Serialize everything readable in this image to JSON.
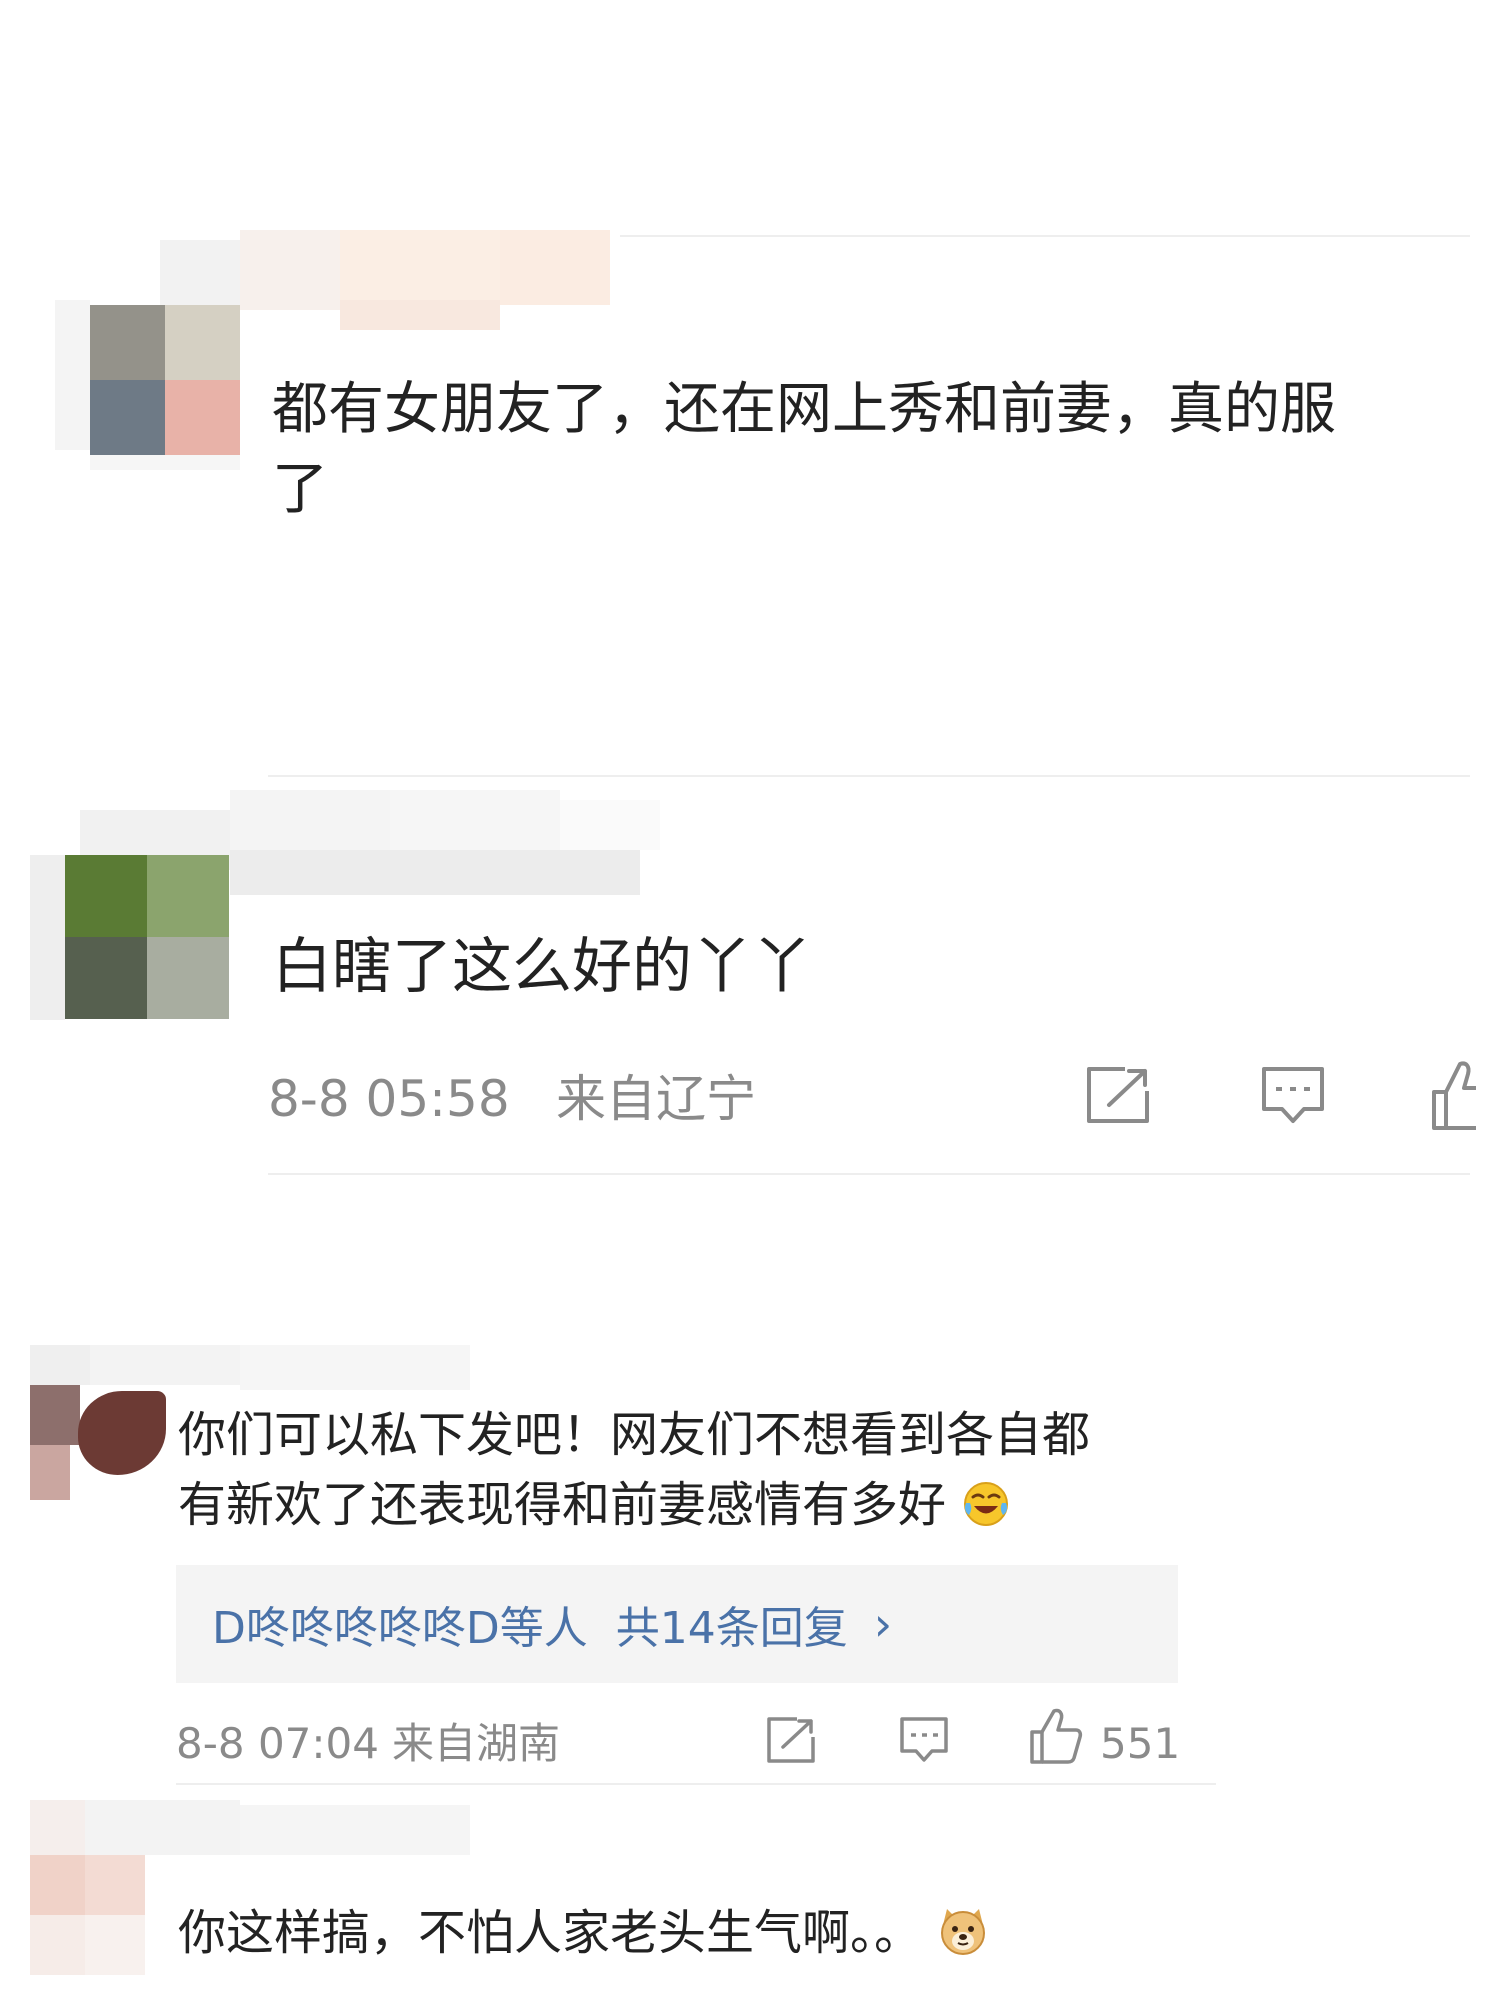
{
  "comments": [
    {
      "text_line1": "都有女朋友了，还在网上秀和前妻，真的服",
      "text_line2": "了"
    },
    {
      "text": "白瞎了这么好的丫丫",
      "time": "8-8 05:58",
      "location": "来自辽宁"
    },
    {
      "text_line1": "你们可以私下发吧！网友们不想看到各自都",
      "text_line2": "有新欢了还表现得和前妻感情有多好",
      "emoji": "crying-laughing-emoji",
      "replies": {
        "users": "D咚咚咚咚咚D等人",
        "count": "共14条回复",
        "chevron": "›"
      },
      "time": "8-8 07:04",
      "location": "来自湖南",
      "likes": "551"
    },
    {
      "text": "你这样搞，不怕人家老头生气啊。。",
      "emoji": "doge-emoji"
    }
  ],
  "icons": {
    "share": "share-icon",
    "comment": "comment-icon",
    "like": "thumbs-up-icon"
  },
  "colors": {
    "text": "#222222",
    "meta": "#8a8a8a",
    "link": "#4a72a8",
    "reply_bg": "#f4f4f4",
    "divider": "#eeeeee"
  }
}
